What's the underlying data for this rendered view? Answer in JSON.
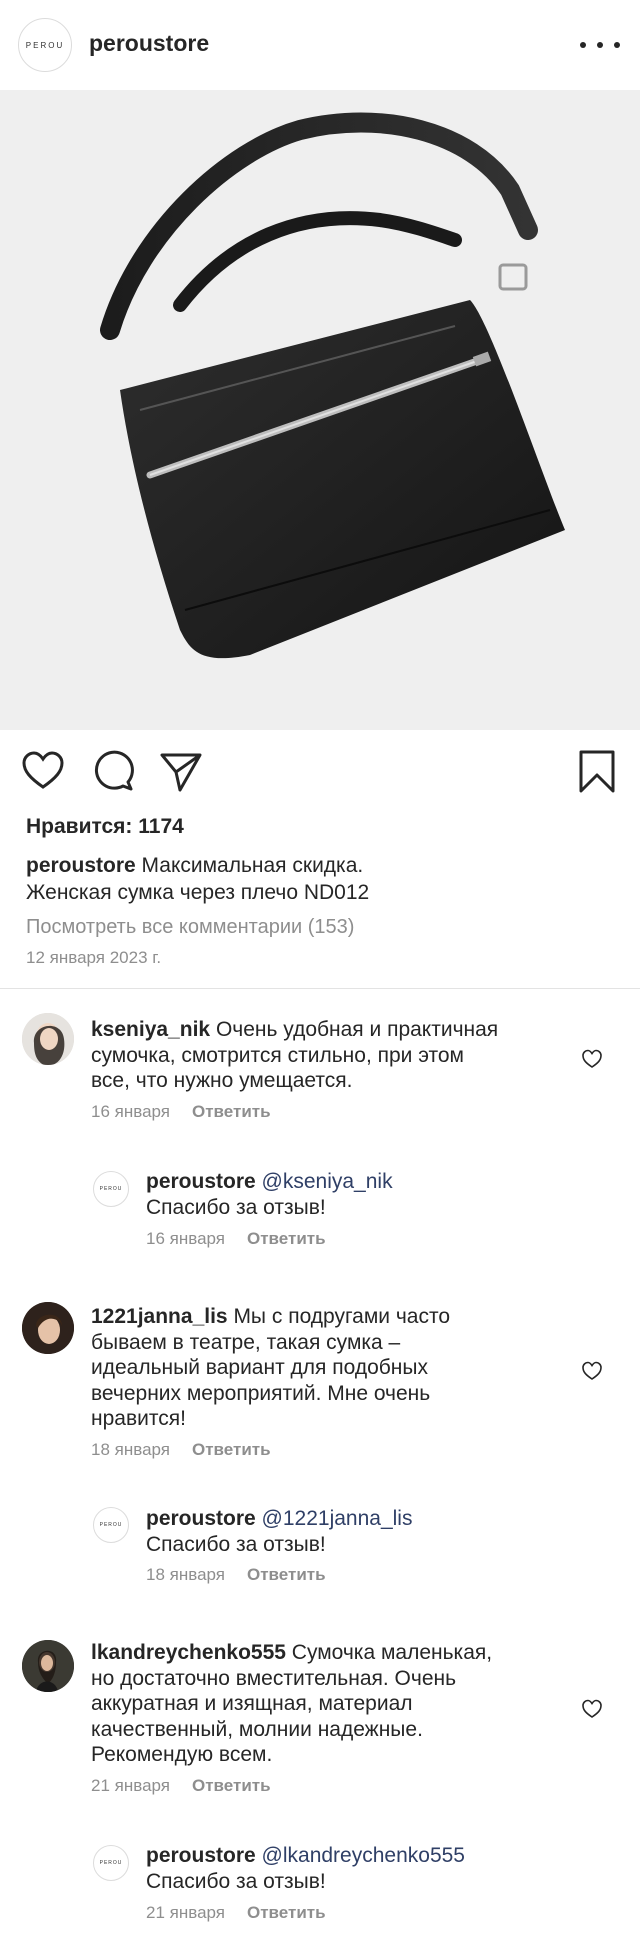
{
  "header": {
    "logo_text": "PEROU",
    "username": "peroustore"
  },
  "post": {
    "likes": "Нравится: 1174",
    "caption_user": "peroustore",
    "caption_line1": "Максимальная скидка.",
    "caption_line2": "Женская сумка через плечо ND012",
    "view_all": "Посмотреть все комментарии (153)",
    "date": "12 января 2023 г."
  },
  "icons": {
    "like": "heart-icon",
    "comment": "comment-bubble-icon",
    "share": "paper-plane-icon",
    "save": "bookmark-icon"
  },
  "reply_label": "Ответить",
  "comments": [
    {
      "user": "kseniya_nik",
      "lines": [
        "Очень удобная и практичная",
        "сумочка, смотрится стильно, при этом",
        "все, что нужно умещается."
      ],
      "date": "16 января",
      "reply": {
        "user": "peroustore",
        "mention": "@kseniya_nik",
        "text": "Спасибо за отзыв!",
        "date": "16 января"
      }
    },
    {
      "user": "1221janna_lis",
      "lines": [
        "Мы с подругами часто",
        "бываем в театре, такая сумка –",
        "идеальный вариант для подобных",
        "вечерних мероприятий. Мне очень",
        "нравится!"
      ],
      "date": "18 января",
      "reply": {
        "user": "peroustore",
        "mention": "@1221janna_lis",
        "text": "Спасибо за отзыв!",
        "date": "18 января"
      }
    },
    {
      "user": "lkandreychenko555",
      "lines": [
        "Сумочка маленькая,",
        "но достаточно вместительная. Очень",
        "аккуратная и изящная, материал",
        "качественный, молнии надежные.",
        "Рекомендую всем."
      ],
      "date": "21 января",
      "reply": {
        "user": "peroustore",
        "mention": "@lkandreychenko555",
        "text": "Спасибо за отзыв!",
        "date": "21 января"
      }
    }
  ]
}
